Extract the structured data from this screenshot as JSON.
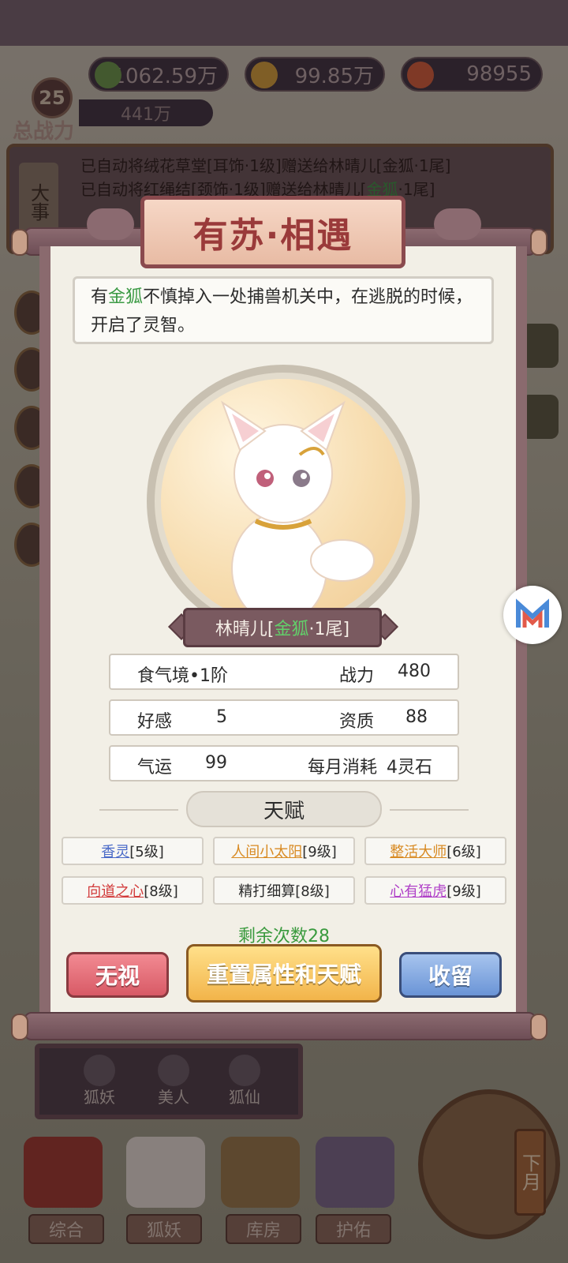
{
  "resources": {
    "leaf_value": "1062.59万",
    "gold_value": "99.85万",
    "gem_value": "98955"
  },
  "player": {
    "level": "25",
    "power_label": "总战力",
    "power_value": "441万"
  },
  "log": {
    "tag": "大事",
    "line1": "已自动将绒花草堂[耳饰·1级]赠送给林晴儿[金狐·1尾]",
    "line2_prefix": "已自动将红绳结[颈饰·1级]赠送给林晴儿[",
    "line2_green": "金狐",
    "line2_suffix": "·1尾]"
  },
  "dialog": {
    "title": "有苏·相遇",
    "desc_prefix": "有",
    "desc_green": "金狐",
    "desc_suffix": "不慎掉入一处捕兽机关中，在逃脱的时候，开启了灵智。",
    "name_prefix": "林晴儿[",
    "name_green": "金狐",
    "name_suffix": "·1尾]",
    "stats": {
      "realm": "食气境•1阶",
      "power_label": "战力",
      "power_value": "480",
      "favor_label": "好感",
      "favor_value": "5",
      "aptitude_label": "资质",
      "aptitude_value": "88",
      "luck_label": "气运",
      "luck_value": "99",
      "cost_label": "每月消耗",
      "cost_value": "4灵石"
    },
    "talent_heading": "天赋",
    "talents": [
      {
        "name": "香灵",
        "level": "[5级]",
        "color": "#4a6ac8"
      },
      {
        "name": "人间小太阳",
        "level": "[9级]",
        "color": "#d88a22"
      },
      {
        "name": "整活大师",
        "level": "[6级]",
        "color": "#d88a22"
      },
      {
        "name": "向道之心",
        "level": "[8级]",
        "color": "#d23a3a"
      },
      {
        "name": "精打细算",
        "level": "[8级]",
        "color": "#2c2c2c"
      },
      {
        "name": "心有猛虎",
        "level": "[9级]",
        "color": "#b040c8"
      }
    ],
    "remaining": "剩余次数28",
    "buttons": {
      "ignore": "无视",
      "reset": "重置属性和天赋",
      "keep": "收留"
    }
  },
  "categories": [
    "狐妖",
    "美人",
    "狐仙"
  ],
  "nav": [
    "综合",
    "狐妖",
    "库房",
    "护佑"
  ],
  "month_label": "下月"
}
